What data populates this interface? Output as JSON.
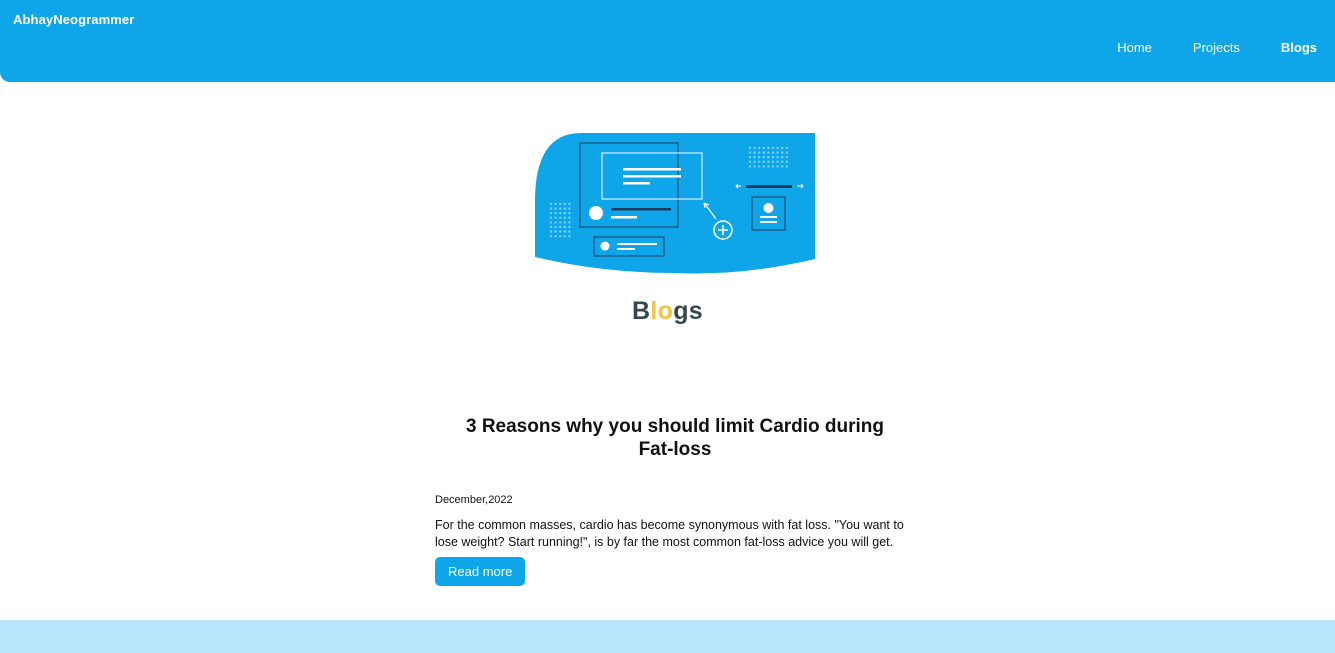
{
  "brand": "AbhayNeogrammer",
  "nav": {
    "items": [
      {
        "label": "Home"
      },
      {
        "label": "Projects"
      },
      {
        "label": "Blogs"
      }
    ]
  },
  "page": {
    "title_start": "B",
    "title_accent": "lo",
    "title_end": "gs"
  },
  "posts": [
    {
      "title": "3 Reasons why you should limit Cardio during Fat-loss",
      "date": "December,2022",
      "excerpt": "For the common masses, cardio has become synonymous with fat loss. \"You want to lose weight? Start running!\", is by far the most common fat-loss advice you will get.",
      "button_label": "Read more"
    }
  ],
  "colors": {
    "primary": "#0ea5e9",
    "accent": "#f6c23e",
    "heading": "#37474f",
    "footer": "#bae6fd"
  }
}
